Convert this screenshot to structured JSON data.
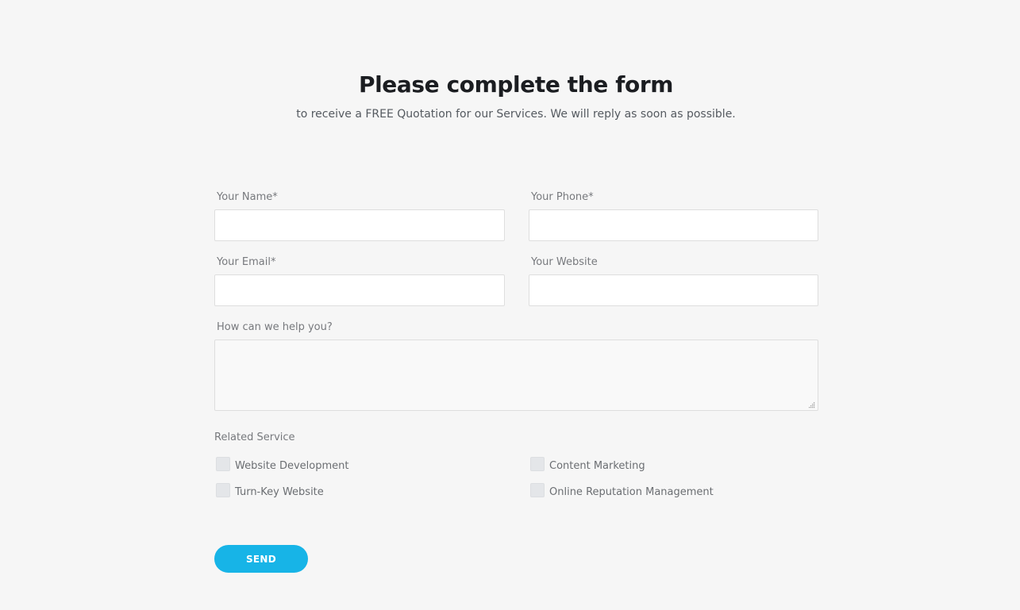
{
  "header": {
    "title": "Please complete the form",
    "subtitle": "to receive a FREE Quotation for our Services. We will reply as soon as possible."
  },
  "form": {
    "name_label": "Your Name*",
    "name_value": "",
    "phone_label": "Your Phone*",
    "phone_value": "",
    "email_label": "Your Email*",
    "email_value": "",
    "website_label": "Your Website",
    "website_value": "",
    "message_label": "How can we help you?",
    "message_value": ""
  },
  "services": {
    "label": "Related Service",
    "options": [
      {
        "label": "Website Development",
        "checked": false
      },
      {
        "label": "Content Marketing",
        "checked": false
      },
      {
        "label": "Turn-Key Website",
        "checked": false
      },
      {
        "label": "Online Reputation Management",
        "checked": false
      }
    ]
  },
  "actions": {
    "send_label": "SEND"
  },
  "colors": {
    "accent": "#17b4e7",
    "background": "#f6f6f6",
    "title": "#1b1d21"
  }
}
